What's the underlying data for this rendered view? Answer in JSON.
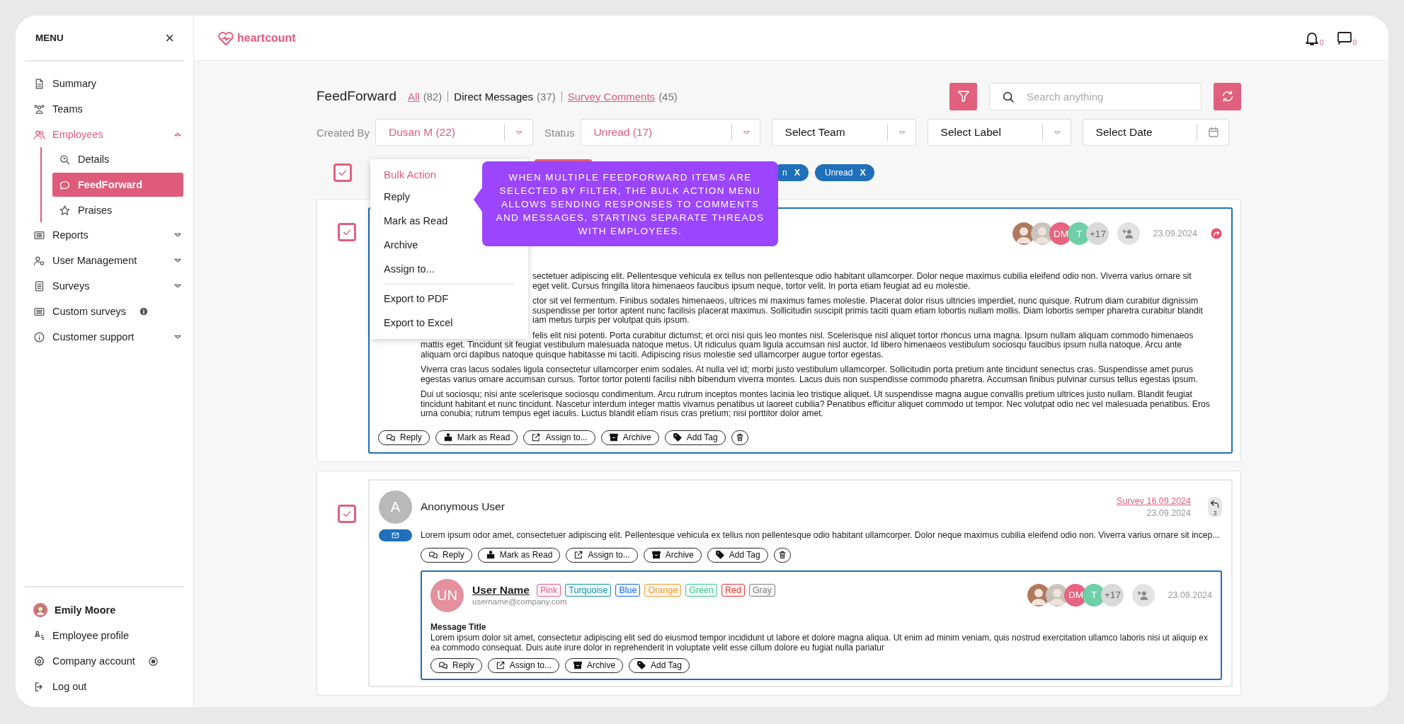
{
  "sidebar": {
    "title": "MENU",
    "close": "×",
    "items": [
      {
        "label": "Summary",
        "kind": "link",
        "active": false
      },
      {
        "label": "Teams",
        "kind": "link",
        "active": false
      },
      {
        "label": "Employees",
        "kind": "group",
        "active": true,
        "expanded": true,
        "children": [
          {
            "label": "Details",
            "selected": false
          },
          {
            "label": "FeedForward",
            "selected": true
          },
          {
            "label": "Praises",
            "selected": false
          }
        ]
      },
      {
        "label": "Reports",
        "kind": "group",
        "active": false,
        "expanded": false
      },
      {
        "label": "User Management",
        "kind": "group",
        "active": false,
        "expanded": false
      },
      {
        "label": "Surveys",
        "kind": "group",
        "active": false,
        "expanded": false
      },
      {
        "label": "Custom surveys",
        "kind": "link",
        "active": false
      },
      {
        "label": "Customer support",
        "kind": "group",
        "active": false,
        "expanded": false
      }
    ],
    "user": {
      "name": "Emily Moore"
    },
    "account_items": [
      {
        "label": "Employee profile"
      },
      {
        "label": "Company account"
      },
      {
        "label": "Log out"
      }
    ]
  },
  "header": {
    "logo": "heartcount",
    "notifications": [
      {
        "kind": "bell",
        "count": "0"
      },
      {
        "kind": "chat",
        "count": "0"
      }
    ]
  },
  "page": {
    "title": "FeedForward",
    "tabs": [
      {
        "label": "All",
        "count": "(82)",
        "selected": false
      },
      {
        "label": "Direct Messages",
        "count": "(37)",
        "selected": true
      },
      {
        "label": "Survey Comments",
        "count": "(45)",
        "selected": false
      }
    ],
    "search": {
      "placeholder": "Search anything"
    },
    "filters": [
      {
        "label": "Created By",
        "value": "Dusan M (22)",
        "applied": true,
        "kind": "dropdown"
      },
      {
        "label": "Status",
        "value": "Unread (17)",
        "applied": true,
        "kind": "dropdown"
      },
      {
        "value": "Select Team",
        "applied": false,
        "kind": "dropdown"
      },
      {
        "value": "Select Label",
        "applied": false,
        "kind": "dropdown"
      },
      {
        "value": "Select Date",
        "applied": false,
        "kind": "date"
      }
    ],
    "select_all": {
      "checked": true
    },
    "chips": [
      {
        "label": "n",
        "remove": "X"
      },
      {
        "label": "Unread",
        "remove": "X"
      }
    ],
    "bulk_menu": {
      "title": "Bulk Action",
      "groups": [
        [
          "Reply",
          "Mark as Read",
          "Archive",
          "Assign to..."
        ],
        [
          "Export to PDF",
          "Export to Excel"
        ]
      ]
    },
    "tooltip": "WHEN MULTIPLE FEEDFORWARD ITEMS ARE SELECTED BY FILTER, THE BULK ACTION MENU ALLOWS SENDING RESPONSES TO COMMENTS AND MESSAGES, STARTING SEPARATE THREADS WITH EMPLOYEES.",
    "cards": [
      {
        "checked": true,
        "focused": true,
        "avatars": [
          {
            "kind": "photo"
          },
          {
            "kind": "photo"
          },
          {
            "kind": "initials",
            "text": "DM",
            "color": "#e8637f"
          },
          {
            "kind": "initials",
            "text": "T",
            "color": "#6fcfa6"
          },
          {
            "kind": "count",
            "text": "+17"
          }
        ],
        "date": "23.09.2024",
        "paragraphs": [
          {
            "kind": "under_menu",
            "lines": [
              "sectetuer adipiscing elit. Pellentesque vehicula ex tellus non pellentesque odio habitant ullamcorper. Dolor neque maximus cubilia eleifend odio non. Viverra varius ornare sit",
              "eget velit. Cursus fringilla litora himenaeos faucibus ipsum neque, tortor velit. In porta etiam feugiat ad eu molestie."
            ]
          },
          {
            "kind": "under_menu",
            "lines": [
              "ctor sit vel fermentum. Finibus sodales himenaeos, ultrices mi maximus fames molestie. Placerat dolor risus ultricies imperdiet, nunc quisque. Rutrum diam curabitur dignissim",
              "suspendisse per tortor aptent nunc facilisis placerat maximus. Sollicitudin suscipit primis taciti quam etiam lobortis nullam mollis. Diam lobortis semper pharetra curabitur blandit",
              "iam metus turpis per volutpat quis ipsum."
            ]
          },
          {
            "kind": "first_line_under_menu",
            "lines": [
              "felis elit nisi potenti. Porta curabitur dictumst; et orci nisi quis leo montes nisl. Scelerisque nisl aliquet tortor rhoncus urna magna. Ipsum nullam aliquam commodo himenaeos",
              "mattis eget. Tincidunt sit feugiat vestibulum malesuada natoque metus. Ut ridiculus quam ligula accumsan nisl auctor. Id libero himenaeos vestibulum sociosqu faucibus ipsum nulla natoque. Arcu ante",
              "aliquam orci dapibus natoque quisque habitasse mi taciti. Adipiscing risus molestie sed ullamcorper augue tortor egestas."
            ]
          },
          {
            "kind": "plain",
            "lines": [
              "Viverra cras lacus sodales ligula consectetur ullamcorper enim sodales. At nulla vel id; morbi justo vestibulum ullamcorper. Sollicitudin porta pretium ante tincidunt senectus cras. Suspendisse amet purus",
              "egestas varius ornare accumsan cursus. Tortor tortor potenti facilisi nibh bibendum viverra montes. Lacus duis non suspendisse commodo pharetra. Accumsan finibus pulvinar cursus tellus egestas ipsum."
            ]
          },
          {
            "kind": "plain",
            "lines": [
              "Dui ut sociosqu; nisi ante scelerisque sociosqu condimentum. Arcu rutrum inceptos montes lacinia leo tristique aliquet. Ut suspendisse magna augue convallis pretium ultrices justo nullam. Blandit feugiat",
              "tincidunt habitant et nunc tincidunt. Nascetur interdum integer mattis vivamus penatibus ut laoreet cubilia? Penatibus efficitur aliquet commodo ut tempor. Nec volutpat odio nec vel malesuada penatibus. Eros",
              "urna conubia; rutrum tempus eget iaculis. Luctus blandit etiam risus cras pretium; nisi porttitor dolor amet."
            ]
          }
        ],
        "actions": [
          {
            "kind": "reply",
            "label": "Reply"
          },
          {
            "kind": "mark_read",
            "label": "Mark as Read"
          },
          {
            "kind": "assign",
            "label": "Assign to..."
          },
          {
            "kind": "archive",
            "label": "Archive"
          },
          {
            "kind": "tag",
            "label": "Add Tag"
          },
          {
            "kind": "delete"
          }
        ]
      },
      {
        "checked": true,
        "focused": false,
        "initial": "A",
        "author": "Anonymous User",
        "survey_link": "Survey 16.09.2024",
        "date": "23.09.2024",
        "reply_count": "3",
        "preview": "Lorem ipsum odor amet, consectetuer adipiscing elit. Pellentesque vehicula ex tellus non pellentesque odio habitant ullamcorper. Dolor neque maximus cubilia eleifend odio non. Viverra varius ornare sit incep...",
        "actions": [
          {
            "kind": "reply",
            "label": "Reply"
          },
          {
            "kind": "mark_read",
            "label": "Mark as Read"
          },
          {
            "kind": "assign",
            "label": "Assign to..."
          },
          {
            "kind": "archive",
            "label": "Archive"
          },
          {
            "kind": "tag",
            "label": "Add Tag"
          },
          {
            "kind": "delete"
          }
        ],
        "thread": {
          "initials": "UN",
          "name": "User Name",
          "email": "username@company.com",
          "tags": [
            {
              "label": "Pink",
              "color": "#e8608a"
            },
            {
              "label": "Turquoise",
              "color": "#1b97a6"
            },
            {
              "label": "Blue",
              "color": "#2370e8"
            },
            {
              "label": "Orange",
              "color": "#f39a2e"
            },
            {
              "label": "Green",
              "color": "#3dc88f"
            },
            {
              "label": "Red",
              "color": "#e03c3c"
            },
            {
              "label": "Gray",
              "color": "#808080"
            }
          ],
          "avatars": [
            {
              "kind": "photo"
            },
            {
              "kind": "photo"
            },
            {
              "kind": "initials",
              "text": "DM",
              "color": "#e8637f"
            },
            {
              "kind": "initials",
              "text": "T",
              "color": "#6fcfa6"
            },
            {
              "kind": "count",
              "text": "+17"
            }
          ],
          "date": "23.09.2024",
          "title": "Message Title",
          "body": "Lorem ipsum dolor sit amet, consectetur adipiscing elit sed do eiusmod tempor incididunt ut labore et dolore magna aliqua. Ut enim ad minim veniam, quis nostrud exercitation ullamco laboris nisi ut aliquip ex ea commodo consequat. Duis aute irure dolor in reprehenderit in voluptate velit esse cillum dolore eu fugiat nulla pariatur",
          "actions": [
            {
              "kind": "reply",
              "label": "Reply"
            },
            {
              "kind": "assign",
              "label": "Assign to..."
            },
            {
              "kind": "archive",
              "label": "Archive"
            },
            {
              "kind": "tag",
              "label": "Add Tag"
            }
          ]
        }
      }
    ]
  }
}
